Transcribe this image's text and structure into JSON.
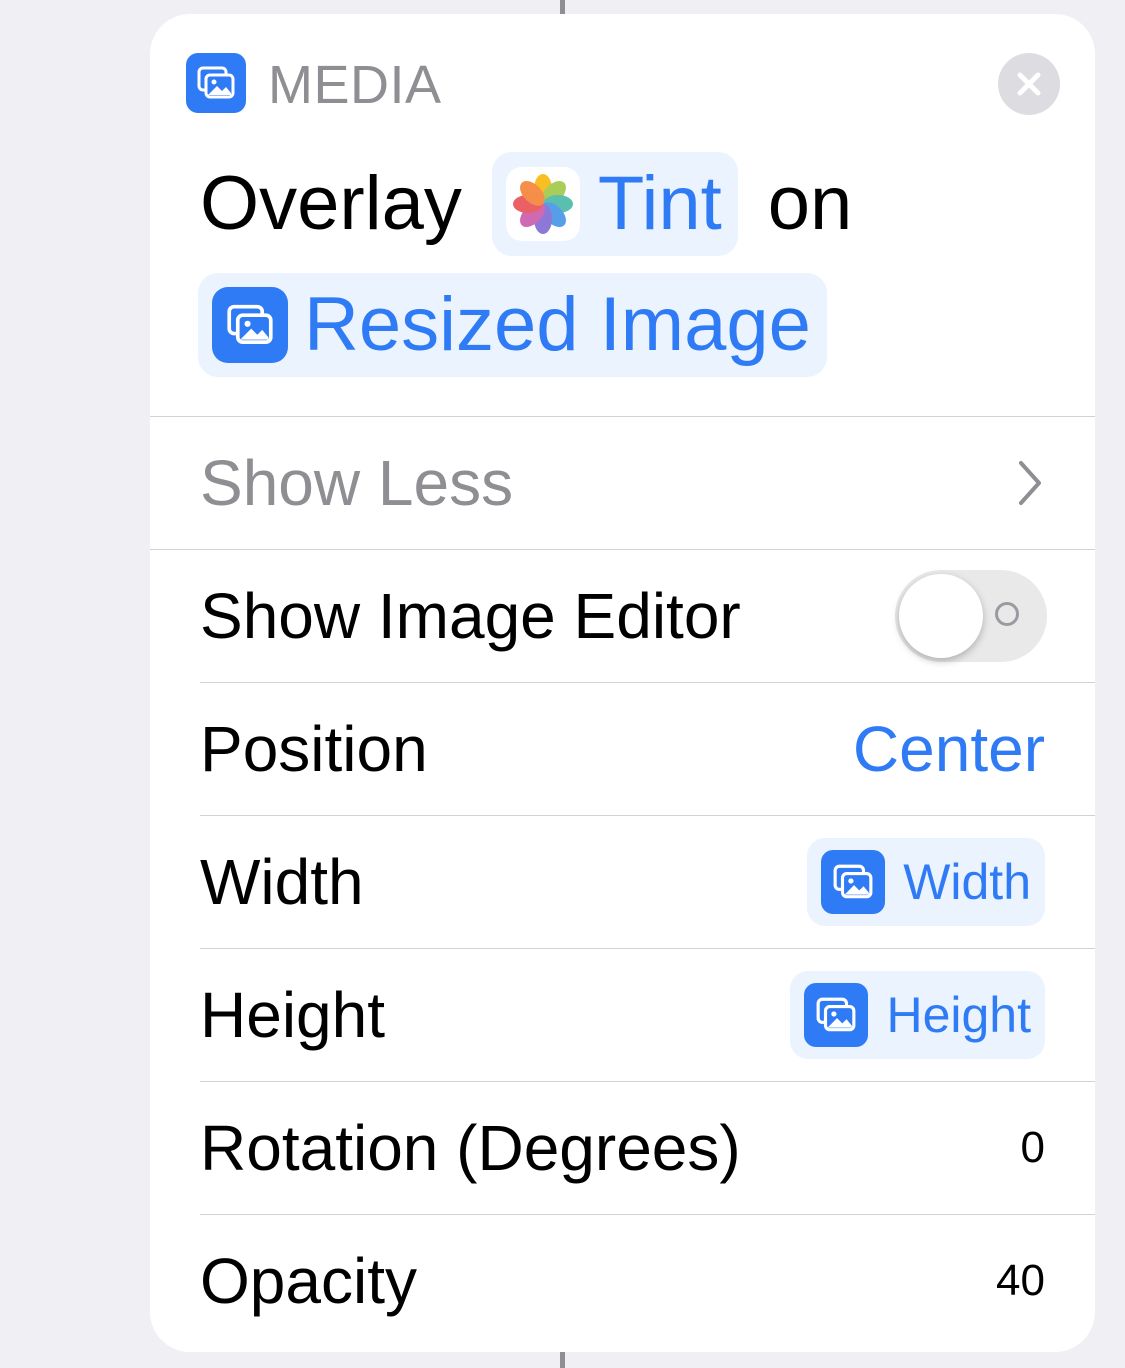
{
  "header": {
    "category_label": "MEDIA",
    "category_icon": "photo-stack-icon",
    "close_icon": "close-icon"
  },
  "action": {
    "verb": "Overlay",
    "input_image": {
      "label": "Tint",
      "icon": "photos-app-icon"
    },
    "connector": "on",
    "target_image": {
      "label": "Resized Image",
      "icon": "photo-stack-icon"
    }
  },
  "show_less": {
    "label": "Show Less",
    "icon": "chevron-right-icon"
  },
  "parameters": {
    "show_image_editor": {
      "label": "Show Image Editor",
      "on": false
    },
    "position": {
      "label": "Position",
      "value": "Center"
    },
    "width": {
      "label": "Width",
      "variable": "Width"
    },
    "height": {
      "label": "Height",
      "variable": "Height"
    },
    "rotation": {
      "label": "Rotation (Degrees)",
      "value": "0"
    },
    "opacity": {
      "label": "Opacity",
      "value": "40"
    }
  },
  "colors": {
    "accent": "#2f7bf5",
    "pill_background": "#eaf3fe",
    "secondary_text": "#8e8e93",
    "page_background": "#efeff4"
  }
}
